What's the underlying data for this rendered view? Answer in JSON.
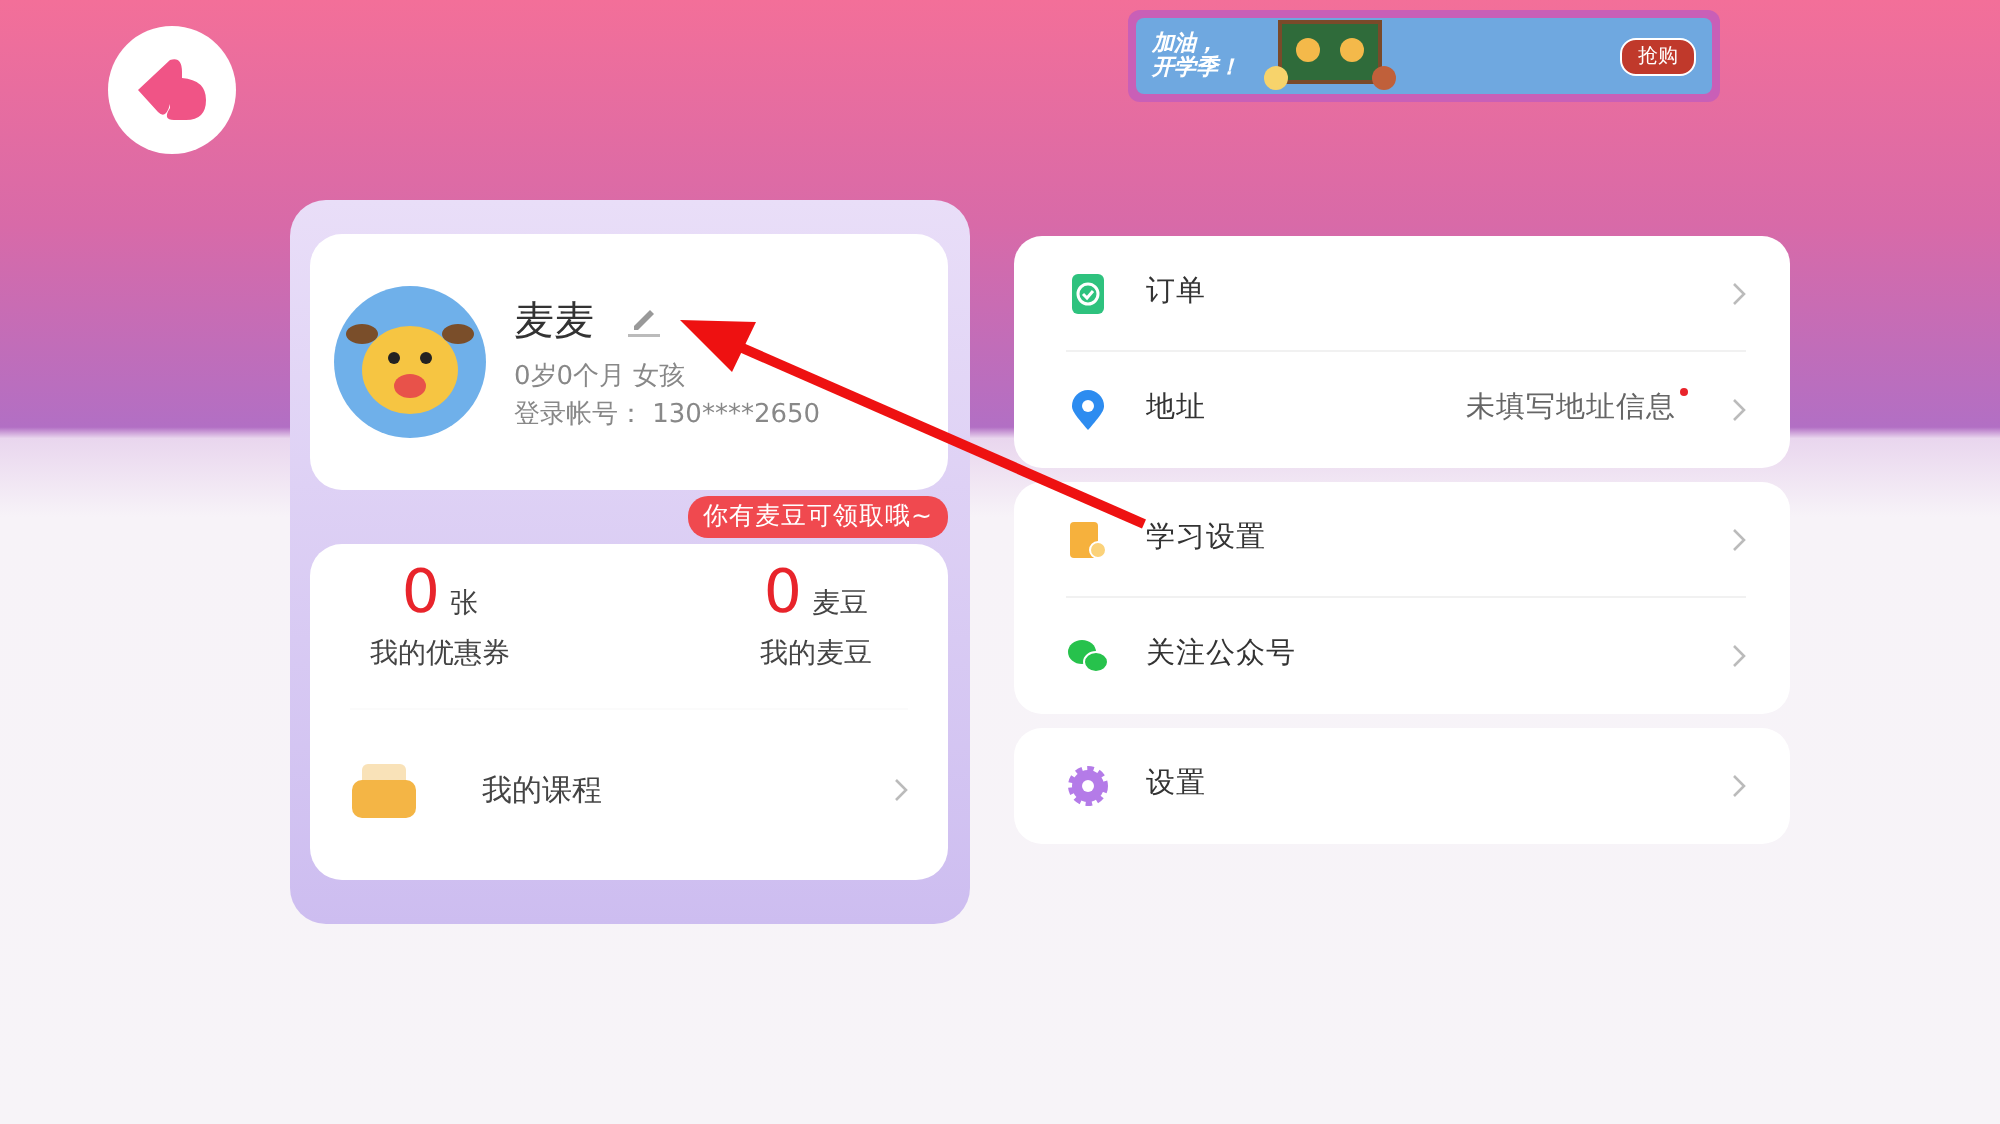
{
  "banner": {
    "headline": [
      "加油，",
      "开学季！"
    ],
    "button": "抢购"
  },
  "profile": {
    "name": "麦麦",
    "age": "0岁0个月",
    "gender": "女孩",
    "account_label": "登录帐号：",
    "account": "130****2650"
  },
  "tooltip": "你有麦豆可领取哦~",
  "stats": [
    {
      "value": "0",
      "unit": "张",
      "label": "我的优惠券"
    },
    {
      "value": "0",
      "unit": "麦豆",
      "label": "我的麦豆"
    }
  ],
  "course": {
    "label": "我的课程"
  },
  "menu_groups": [
    [
      {
        "kind": "order",
        "label": "订单",
        "notice": false
      },
      {
        "kind": "address",
        "label": "地址",
        "value": "未填写地址信息",
        "notice": true
      }
    ],
    [
      {
        "kind": "study",
        "label": "学习设置",
        "notice": false
      },
      {
        "kind": "wechat",
        "label": "关注公众号",
        "notice": false
      }
    ],
    [
      {
        "kind": "settings",
        "label": "设置",
        "notice": false
      }
    ]
  ]
}
